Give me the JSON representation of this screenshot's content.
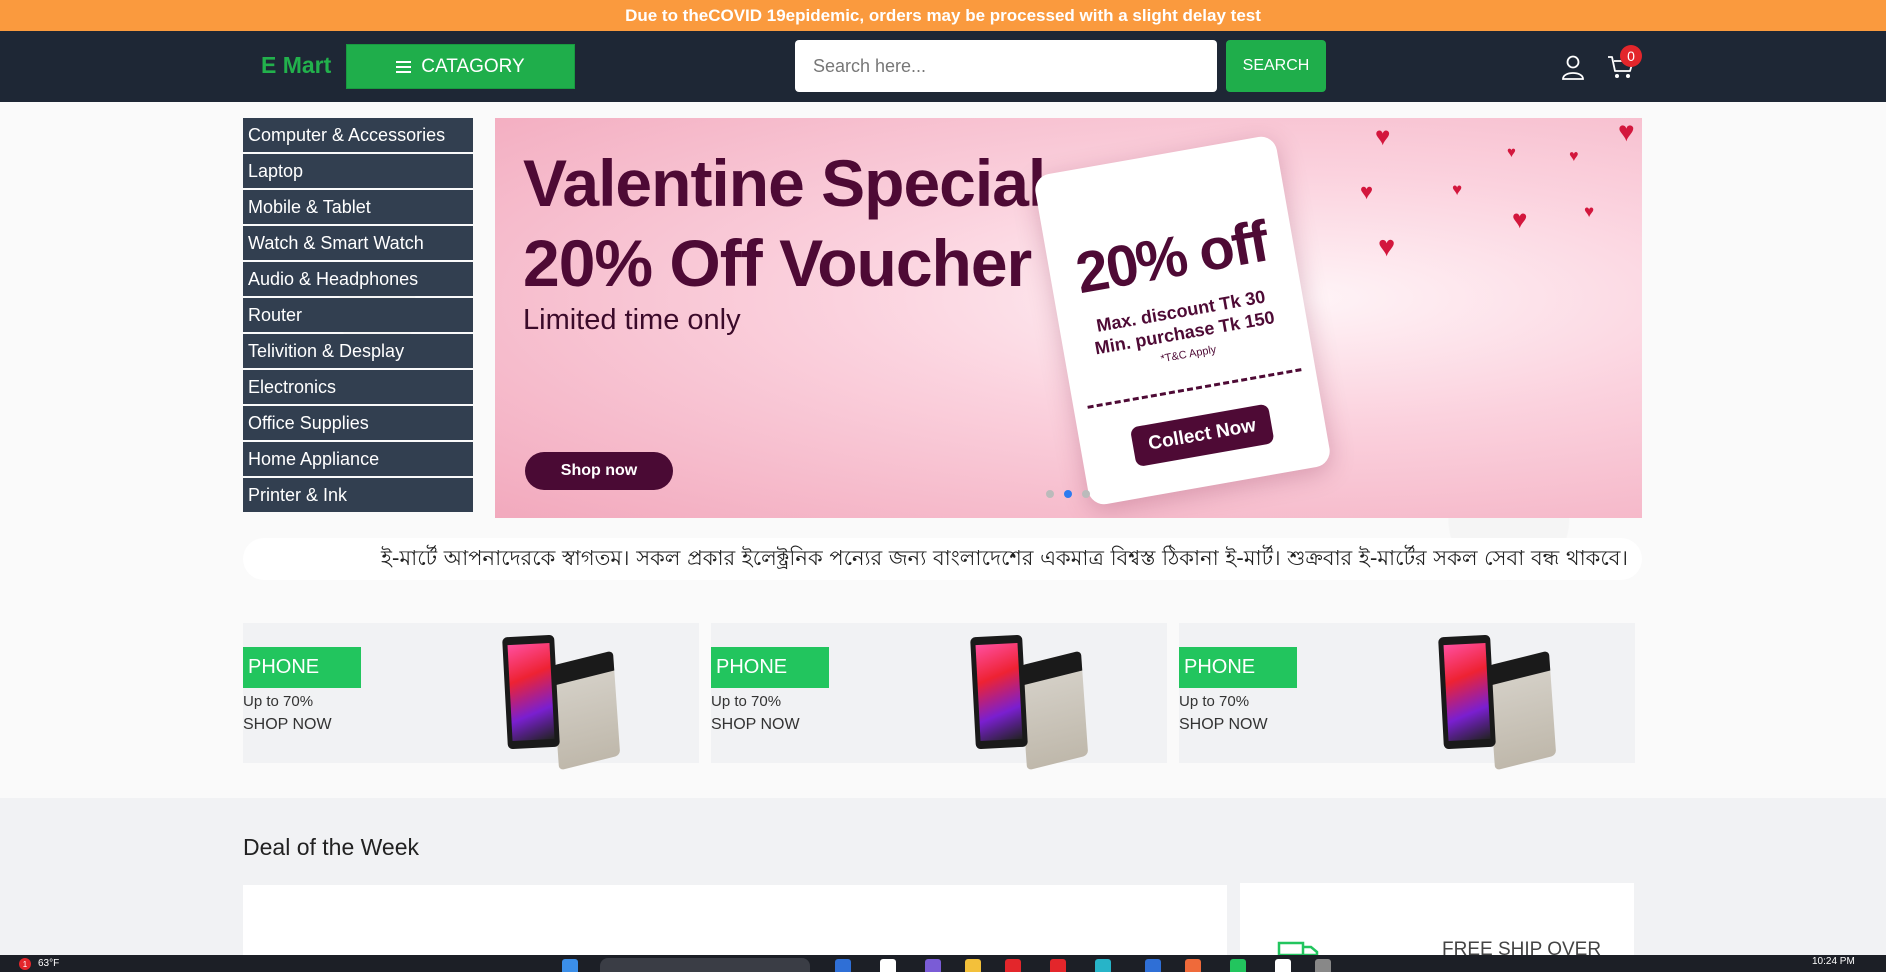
{
  "announcement": {
    "before": "Due to the ",
    "highlight": "COVID 19",
    "after": " epidemic, orders may be processed with a slight delay test"
  },
  "header": {
    "logo": "E Mart",
    "category_label": "CATAGORY",
    "search_placeholder": "Search here...",
    "search_button": "SEARCH",
    "cart_count": "0"
  },
  "categories": [
    "Computer & Accessories",
    "Laptop",
    "Mobile & Tablet",
    "Watch & Smart Watch",
    "Audio & Headphones",
    "Router",
    "Telivition & Desplay",
    "Electronics",
    "Office Supplies",
    "Home Appliance",
    "Printer & Ink"
  ],
  "banner": {
    "title_line1": "Valentine Special",
    "title_line2": "20% Off Voucher",
    "subtitle": "Limited time only",
    "shop_button": "Shop now",
    "voucher_percent": "20% off",
    "voucher_max": "Max. discount Tk 30",
    "voucher_min": "Min. purchase Tk 150",
    "voucher_tc": "*T&C Apply",
    "voucher_button": "Collect Now",
    "slide_count": 3,
    "active_slide": 2
  },
  "marquee": "ই-মার্টে আপনাদেরকে স্বাগতম। সকল প্রকার ইলেক্ট্রনিক পন্যের জন্য বাংলাদেশের একমাত্র বিশ্বস্ত ঠিকানা ই-মার্ট। শুক্রবার ই-মার্টের সকল সেবা বন্ধ থাকবে।",
  "promos": [
    {
      "tag": "PHONE",
      "subtitle": "Up to 70%",
      "link": "SHOP NOW"
    },
    {
      "tag": "PHONE",
      "subtitle": "Up to 70%",
      "link": "SHOP NOW"
    },
    {
      "tag": "PHONE",
      "subtitle": "Up to 70%",
      "link": "SHOP NOW"
    }
  ],
  "deal": {
    "title": "Deal of the Week",
    "free_ship": "FREE SHIP OVER"
  },
  "taskbar": {
    "notification_count": "1",
    "weather": "63°F",
    "time": "10:24 PM"
  },
  "colors": {
    "announcement_bg": "#fa9a3e",
    "header_bg": "#1e2735",
    "accent_green": "#1fae4b",
    "sidebar_bg": "#323f50",
    "banner_text": "#4e0a35",
    "badge_red": "#e3262b"
  },
  "icons": [
    "menu-icon",
    "user-icon",
    "cart-icon",
    "heart-icon",
    "truck-icon"
  ]
}
